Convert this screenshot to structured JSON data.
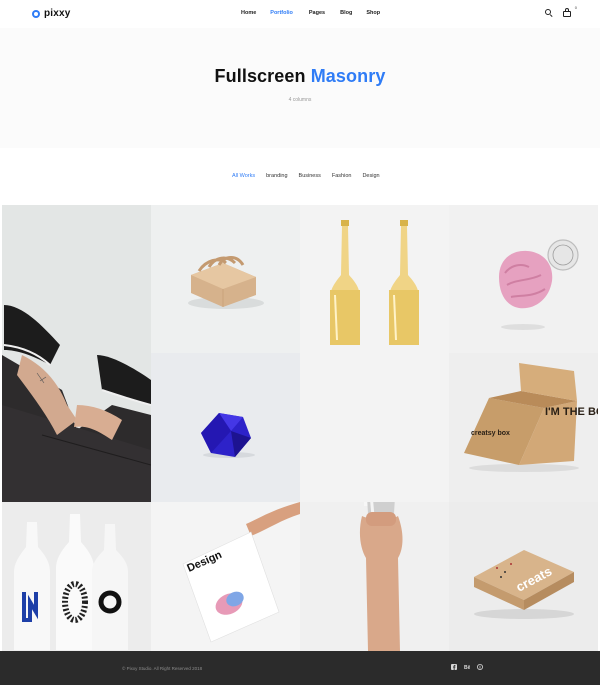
{
  "header": {
    "logo_text": "pixxy",
    "nav": [
      {
        "label": "Home",
        "active": false
      },
      {
        "label": "Portfolio",
        "active": true
      },
      {
        "label": "Pages",
        "active": false
      },
      {
        "label": "Blog",
        "active": false
      },
      {
        "label": "Shop",
        "active": false
      }
    ],
    "search_icon": "search-icon",
    "cart_icon": "shopping-bag-icon",
    "cart_count": "0"
  },
  "hero": {
    "title_main": "Fullscreen",
    "title_accent": "Masonry",
    "subtitle": "4 columns"
  },
  "filters": [
    {
      "label": "All Works",
      "active": true
    },
    {
      "label": "branding",
      "active": false
    },
    {
      "label": "Business",
      "active": false
    },
    {
      "label": "Fashion",
      "active": false
    },
    {
      "label": "Design",
      "active": false
    }
  ],
  "gallery": {
    "box_print_1": "I'M THE BOX",
    "box_print_2": "creatsy box",
    "poster_title": "Design",
    "pizza_box_print": "creats"
  },
  "footer": {
    "copyright": "© Pixxy Studio. All Right Reserved 2018",
    "social": [
      "facebook-icon",
      "behance-icon",
      "pinterest-icon"
    ]
  },
  "colors": {
    "accent": "#2f7cf6",
    "footer_bg": "#2b2b2b"
  }
}
